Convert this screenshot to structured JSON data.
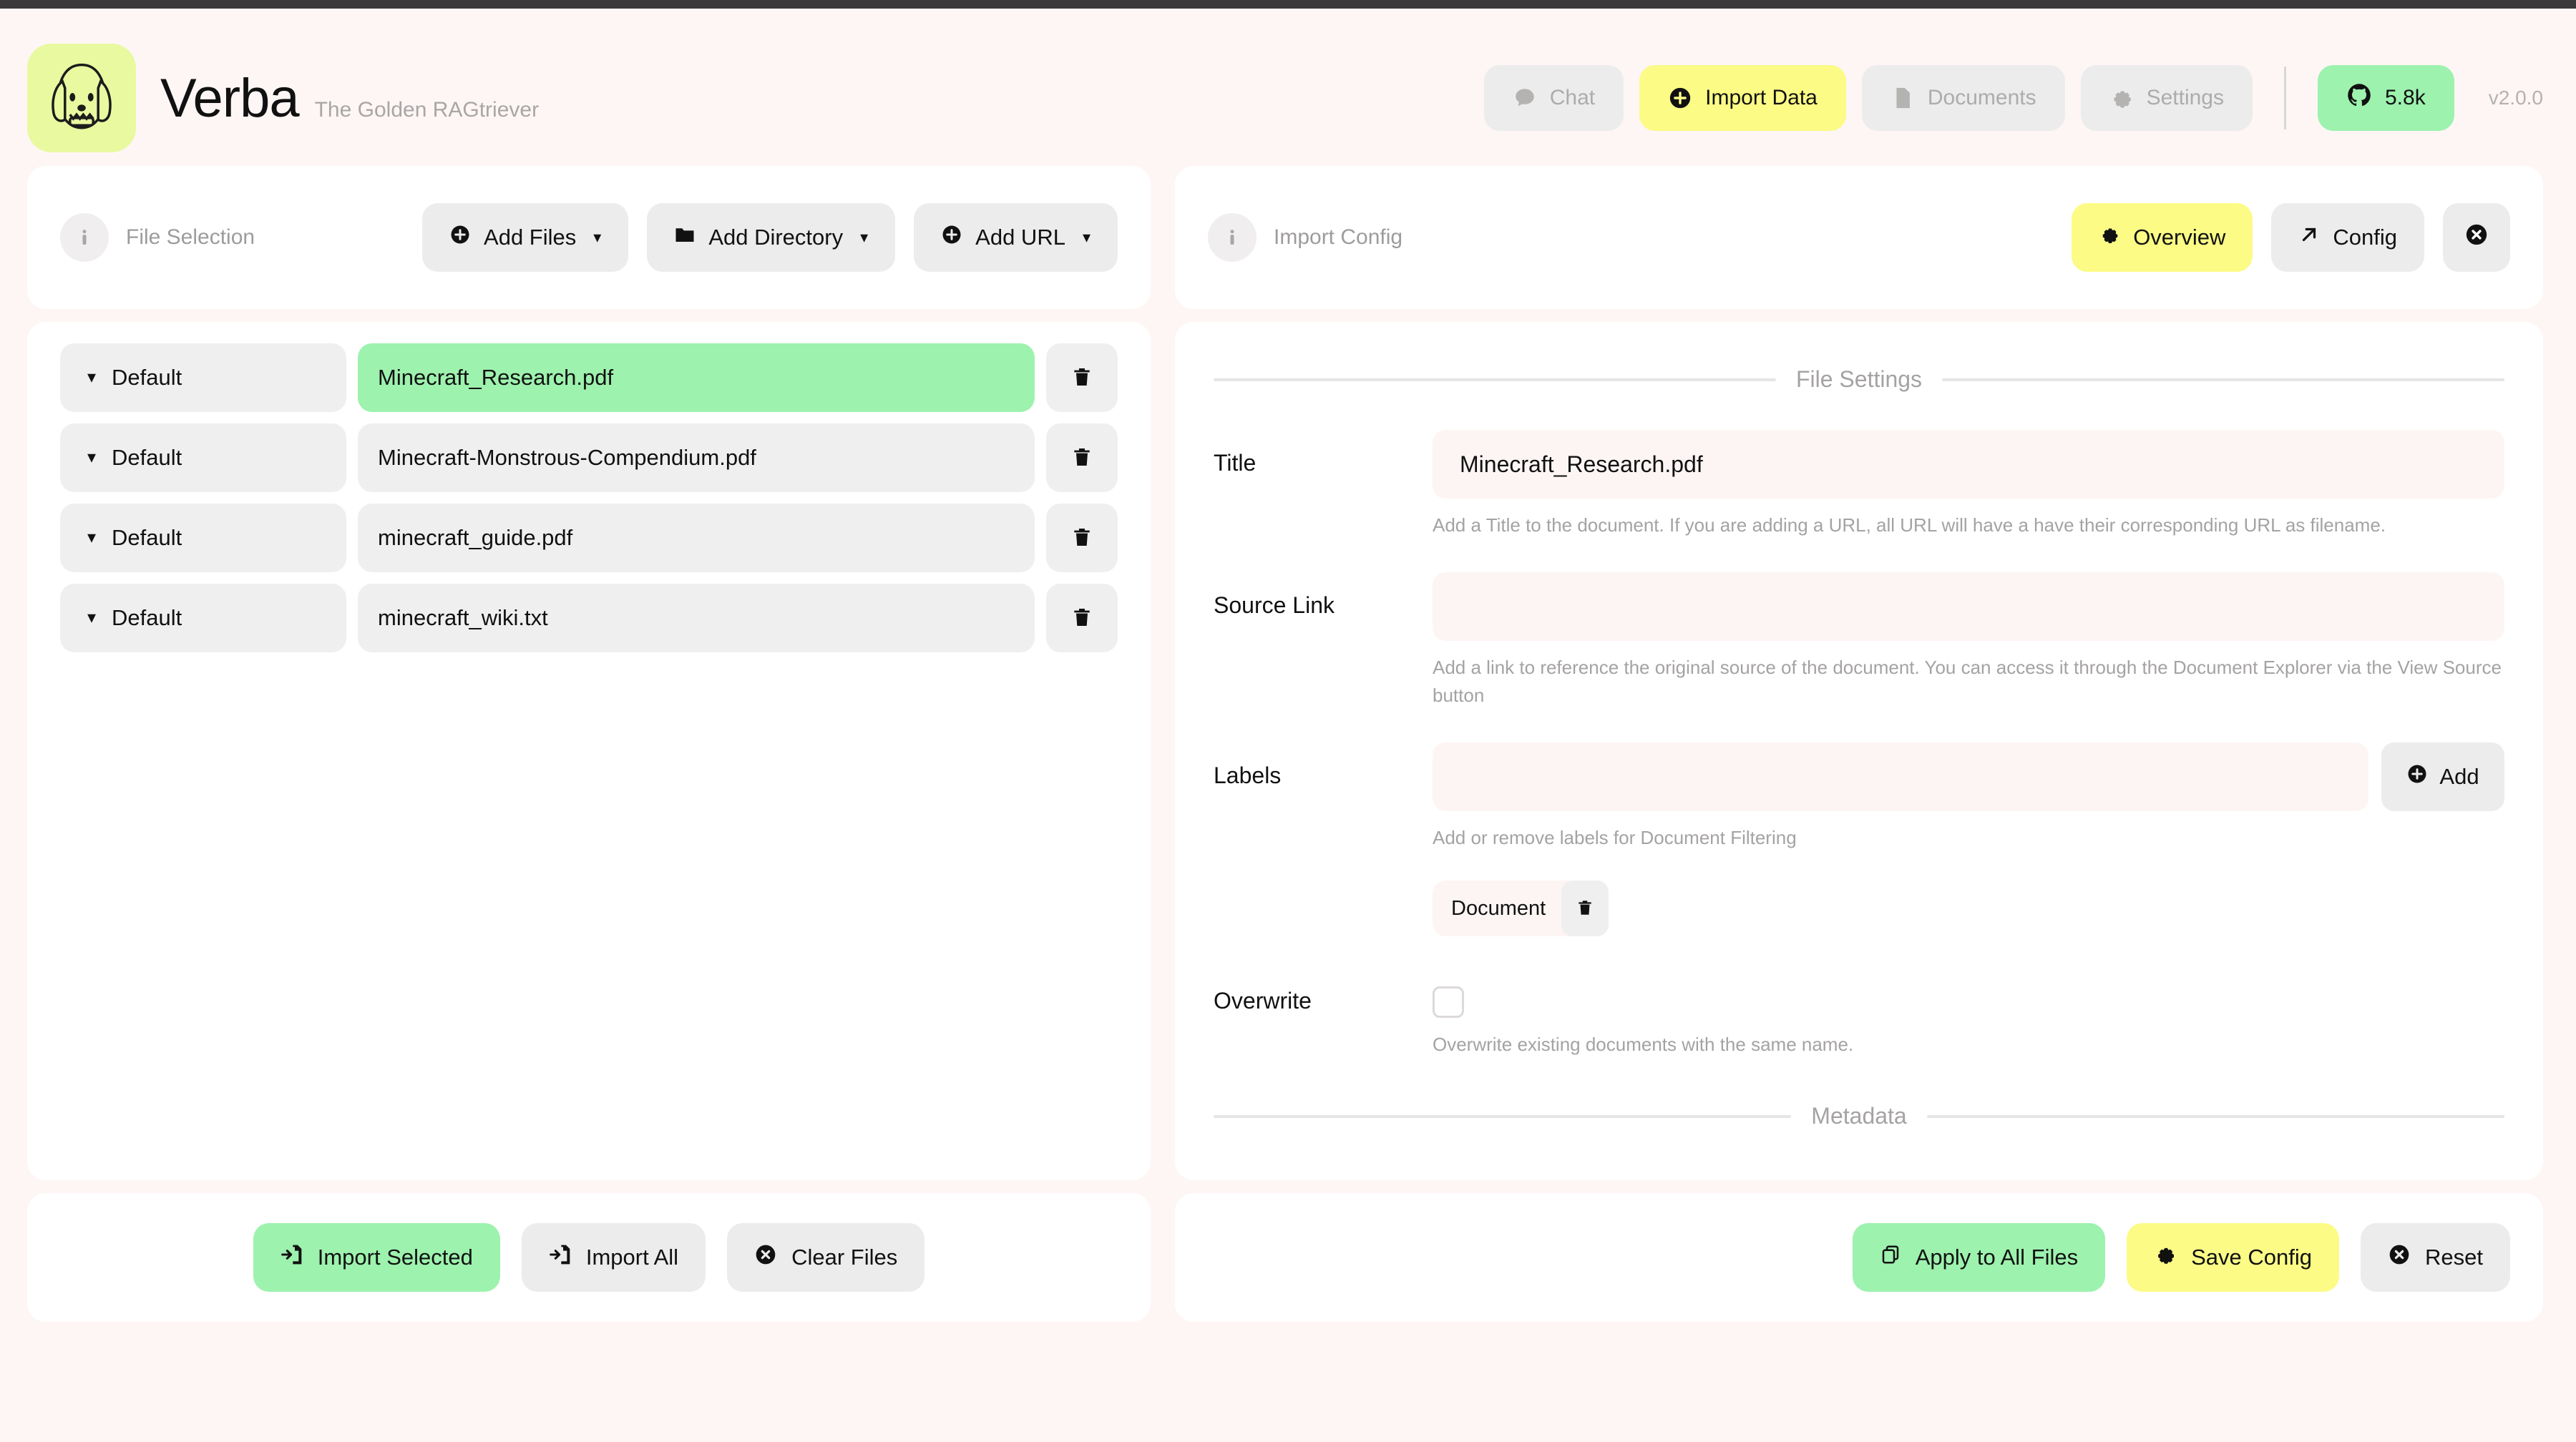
{
  "app": {
    "title": "Verba",
    "tagline": "The Golden RAGtriever",
    "version": "v2.0.0",
    "logo_icon": "dog-face-icon"
  },
  "nav": {
    "items": [
      {
        "label": "Chat",
        "icon": "chat-bubble-icon",
        "active": false
      },
      {
        "label": "Import Data",
        "icon": "plus-circle-icon",
        "active": true
      },
      {
        "label": "Documents",
        "icon": "document-icon",
        "active": false
      },
      {
        "label": "Settings",
        "icon": "gear-icon",
        "active": false
      }
    ],
    "stars": {
      "label": "5.8k",
      "icon": "github-icon"
    }
  },
  "file_selection": {
    "title": "File Selection",
    "info_icon": "info-icon",
    "actions": [
      {
        "label": "Add Files",
        "icon": "plus-circle-icon",
        "caret": "▾"
      },
      {
        "label": "Add Directory",
        "icon": "folder-icon",
        "caret": "▾"
      },
      {
        "label": "Add URL",
        "icon": "plus-circle-icon",
        "caret": "▾"
      }
    ],
    "files": [
      {
        "chunker": "Default",
        "name": "Minecraft_Research.pdf",
        "selected": true
      },
      {
        "chunker": "Default",
        "name": "Minecraft-Monstrous-Compendium.pdf",
        "selected": false
      },
      {
        "chunker": "Default",
        "name": "minecraft_guide.pdf",
        "selected": false
      },
      {
        "chunker": "Default",
        "name": "minecraft_wiki.txt",
        "selected": false
      }
    ],
    "footer_actions": [
      {
        "label": "Import Selected",
        "icon": "file-import-icon",
        "style": "green"
      },
      {
        "label": "Import All",
        "icon": "file-import-icon",
        "style": "grey"
      },
      {
        "label": "Clear Files",
        "icon": "x-circle-icon",
        "style": "grey"
      }
    ]
  },
  "import_config": {
    "title": "Import Config",
    "info_icon": "info-icon",
    "tabs": [
      {
        "label": "Overview",
        "icon": "gear-icon",
        "active": true
      },
      {
        "label": "Config",
        "icon": "arrow-up-right-icon",
        "active": false
      }
    ],
    "close_icon": "x-circle-icon",
    "sections": {
      "file_settings": "File Settings",
      "metadata": "Metadata"
    },
    "fields": {
      "title": {
        "label": "Title",
        "value": "Minecraft_Research.pdf",
        "helper": "Add a Title to the document. If you are adding a URL, all URL will have a have their corresponding URL as filename."
      },
      "source_link": {
        "label": "Source Link",
        "value": "",
        "placeholder": "",
        "helper": "Add a link to reference the original source of the document. You can access it through the Document Explorer via the View Source button"
      },
      "labels": {
        "label": "Labels",
        "value": "",
        "placeholder": "",
        "add_label": "Add",
        "add_icon": "plus-circle-icon",
        "helper": "Add or remove labels for Document Filtering",
        "chips": [
          {
            "label": "Document",
            "delete_icon": "trash-icon"
          }
        ]
      },
      "overwrite": {
        "label": "Overwrite",
        "checked": false,
        "helper": "Overwrite existing documents with the same name."
      },
      "metadata": {
        "value": ""
      }
    },
    "footer_actions": [
      {
        "label": "Apply to All Files",
        "icon": "copy-icon",
        "style": "green"
      },
      {
        "label": "Save Config",
        "icon": "gear-icon",
        "style": "yellow"
      },
      {
        "label": "Reset",
        "icon": "x-circle-icon",
        "style": "grey"
      }
    ]
  },
  "colors": {
    "page_bg": "#fdf6f5",
    "panel_bg": "#ffffff",
    "accent_yellow": "#fbfb86",
    "accent_green": "#9df2ae",
    "neutral_btn": "#ececec",
    "input_bg": "#fdf5f4",
    "logo_bg": "#e9f9a0"
  }
}
